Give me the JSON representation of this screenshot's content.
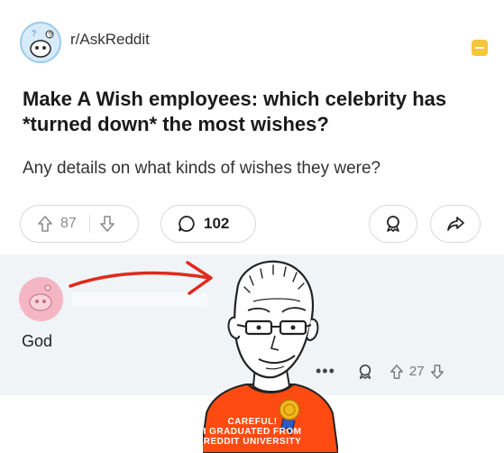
{
  "post": {
    "subreddit": "r/AskReddit",
    "title": "Make A Wish employees: which celebrity has *turned down* the most wishes?",
    "body": "Any details on what kinds of wishes they were?",
    "upvotes": "87",
    "comments": "102"
  },
  "comment": {
    "text": "God",
    "score": "27",
    "more_label": "•••"
  },
  "meme": {
    "shirt_lines": [
      "CAREFUL!",
      "I GRADUATED FROM",
      "REDDIT UNIVERSITY"
    ],
    "arrow_color": "#e02a1c",
    "shirt_color": "#ff4a12"
  },
  "icons": [
    "upvote-icon",
    "downvote-icon",
    "comment-icon",
    "award-icon",
    "share-icon",
    "more-icon"
  ]
}
